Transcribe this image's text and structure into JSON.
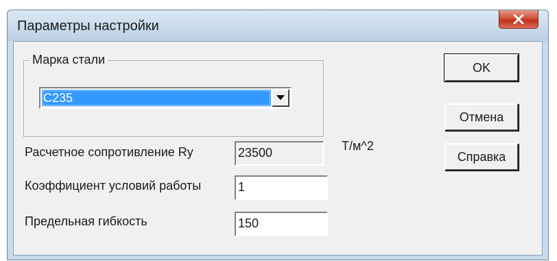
{
  "window": {
    "title": "Параметры настройки",
    "close_icon": "close-icon"
  },
  "steel_group": {
    "label": "Марка стали",
    "selected_value": "С235"
  },
  "fields": {
    "resistance": {
      "label": "Расчетное сопротивление Ry",
      "value": "23500",
      "unit": "Т/м^2"
    },
    "work_coeff": {
      "label": "Коэффициент условий работы",
      "value": "1"
    },
    "flexibility": {
      "label": "Предельная гибкость",
      "value": "150"
    }
  },
  "buttons": {
    "ok": "OK",
    "cancel": "Отмена",
    "help": "Справка"
  },
  "colors": {
    "selection": "#3399ff",
    "close_button": "#c0311a"
  }
}
